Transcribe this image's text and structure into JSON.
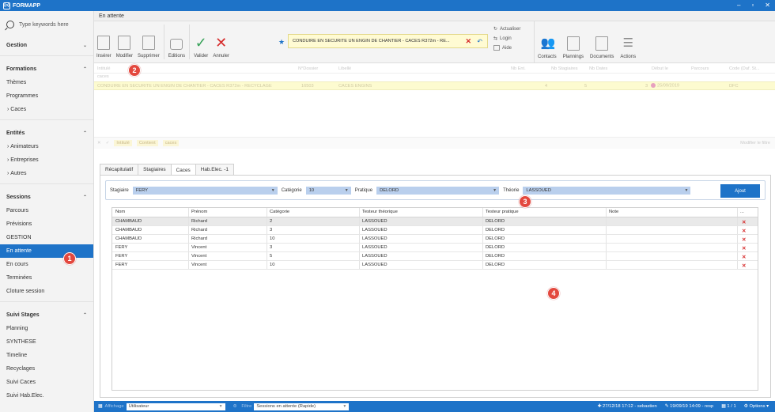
{
  "app": {
    "title": "FORMAPP",
    "logo_mark": "{o}",
    "controls": [
      "–",
      "▫",
      "✕"
    ]
  },
  "sidebar": {
    "search_placeholder": "Type keywords here",
    "sections": {
      "gestion": "Gestion",
      "formations": "Formations",
      "formations_items": [
        "Thèmes",
        "Programmes",
        "Caces"
      ],
      "entites": "Entités",
      "entites_items": [
        "Animateurs",
        "Entreprises",
        "Autres"
      ],
      "sessions": "Sessions",
      "sessions_items": [
        "Parcours",
        "Prévisions",
        "GESTION",
        "En attente",
        "En cours",
        "Terminées",
        "Cloture session"
      ],
      "suivi": "Suivi Stages",
      "suivi_items": [
        "Planning",
        "SYNTHESE",
        "Timeline",
        "Recyclages",
        "Suivi Caces",
        "Suivi Hab.Elec."
      ]
    }
  },
  "ribbon": {
    "title": "En attente",
    "buttons": {
      "inserer": "Insérer",
      "modifier": "Modifier",
      "supprimer": "Supprimer",
      "editions": "Editions",
      "valider": "Valider",
      "annuler": "Annuler"
    },
    "current": "CONDUIRE EN SECURITE UN ENGIN DE CHANTIER - CACES R372m - RE...",
    "small": {
      "actualiser": "Actualiser",
      "login": "Login",
      "aide": "Aide"
    },
    "right": {
      "contacts": "Contacts",
      "plannings": "Plannings",
      "documents": "Documents",
      "actions": "Actions"
    }
  },
  "grid": {
    "headers": [
      "Intitulé",
      "N°Dossier",
      "Libellé",
      "Nb Ent.",
      "Nb Stagiaires",
      "Nb Dates",
      "Début le",
      "Parcours",
      "Code (Daf. St..."
    ],
    "filter_text": "caces",
    "row": {
      "intitule": "CONDUIRE EN SECURITE UN ENGIN DE CHANTIER - CACES R372m - RECYCLAGE",
      "dossier": "16503",
      "libelle": "CACES ENGINS",
      "nb_stag": "4",
      "nb_dates": "5",
      "count": "3",
      "debut": "25/09/2019",
      "code": "DFC"
    },
    "filterbar": {
      "close": "✕",
      "check": "✓",
      "chip1": "Intitulé",
      "chip2": "Contient",
      "chip3": "caces",
      "modify": "Modifier le filtre"
    }
  },
  "tabs": [
    "Récapitulatif",
    "Stagiaires",
    "Caces",
    "Hab.Elec. -1"
  ],
  "form": {
    "stagiaire_label": "Stagiaire",
    "stagiaire_value": "FERY",
    "categorie_label": "Catégorie",
    "categorie_value": "10",
    "pratique_label": "Pratique",
    "pratique_value": "DELORD",
    "theorie_label": "Théorie",
    "theorie_value": "LASSOUED",
    "ajout": "Ajout"
  },
  "table": {
    "headers": [
      "Nom",
      "Prénom",
      "Catégorie",
      "Testeur théorique",
      "Testeur pratique",
      "Note",
      "..."
    ],
    "rows": [
      [
        "CHAMBAUD",
        "Richard",
        "2",
        "LASSOUED",
        "DELORD",
        ""
      ],
      [
        "CHAMBAUD",
        "Richard",
        "3",
        "LASSOUED",
        "DELORD",
        ""
      ],
      [
        "CHAMBAUD",
        "Richard",
        "10",
        "LASSOUED",
        "DELORD",
        ""
      ],
      [
        "FERY",
        "Vincent",
        "3",
        "LASSOUED",
        "DELORD",
        ""
      ],
      [
        "FERY",
        "Vincent",
        "5",
        "LASSOUED",
        "DELORD",
        ""
      ],
      [
        "FERY",
        "Vincent",
        "10",
        "LASSOUED",
        "DELORD",
        ""
      ]
    ],
    "delete_glyph": "✕"
  },
  "badges": [
    "1",
    "2",
    "3",
    "4"
  ],
  "statusbar": {
    "affichage_label": "Affichage",
    "affichage_value": "Utilisateur",
    "filtre_label": "Filtre",
    "filtre_value": "Sessions en attente (Rapide)",
    "created": "27/12/18 17:12 - sebastien",
    "modified": "19/09/19 14:09 - resp",
    "pages": "1 / 1",
    "options": "Options"
  },
  "colors": {
    "accent": "#1e73c8",
    "highlight": "#fdfbd0",
    "delete": "#d62b2b",
    "badge": "#e3483e"
  }
}
